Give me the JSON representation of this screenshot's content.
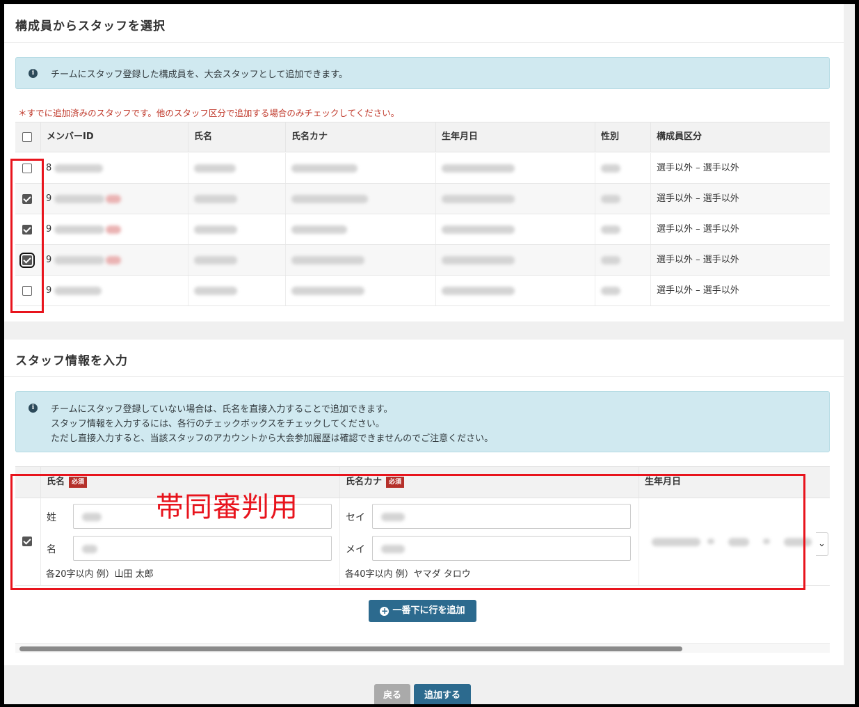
{
  "section_members": {
    "title": "構成員からスタッフを選択",
    "info": "チームにスタッフ登録した構成員を、大会スタッフとして追加できます。",
    "warning": "＊すでに追加済みのスタッフです。他のスタッフ区分で追加する場合のみチェックしてください。",
    "columns": [
      "メンバーID",
      "氏名",
      "氏名カナ",
      "生年月日",
      "性別",
      "構成員区分"
    ],
    "rows": [
      {
        "id_prefix": "8",
        "checked": false,
        "already_added": false,
        "category": "選手以外 – 選手以外"
      },
      {
        "id_prefix": "9",
        "checked": true,
        "already_added": true,
        "category": "選手以外 – 選手以外"
      },
      {
        "id_prefix": "9",
        "checked": true,
        "already_added": true,
        "category": "選手以外 – 選手以外"
      },
      {
        "id_prefix": "9",
        "checked": true,
        "already_added": true,
        "category": "選手以外 – 選手以外"
      },
      {
        "id_prefix": "9",
        "checked": false,
        "already_added": false,
        "category": "選手以外 – 選手以外"
      }
    ]
  },
  "section_input": {
    "title": "スタッフ情報を入力",
    "info_lines": [
      "チームにスタッフ登録していない場合は、氏名を直接入力することで追加できます。",
      "スタッフ情報を入力するには、各行のチェックボックスをチェックしてください。",
      "ただし直接入力すると、当該スタッフのアカウントから大会参加履歴は確認できませんのでご注意ください。"
    ],
    "columns": {
      "name": "氏名",
      "kana": "氏名カナ",
      "birthdate": "生年月日",
      "required_badge": "必須"
    },
    "row": {
      "checked": true,
      "sei_label": "姓",
      "mei_label": "名",
      "sei_kana_label": "セイ",
      "mei_kana_label": "メイ",
      "name_hint": "各20字以内 例）山田 太郎",
      "kana_hint": "各40字以内 例）ヤマダ タロウ",
      "select_arrow": "⌄"
    },
    "add_row_button": "一番下に行を追加"
  },
  "annotation": "帯同審判用",
  "footer": {
    "back_button": "戻る",
    "submit_button": "追加する"
  },
  "colors": {
    "accent": "#2c6a8e",
    "annotation_red": "#e8141d",
    "info_bg": "#d0e9f0",
    "warning": "#c0392b",
    "required_badge": "#b5302a"
  }
}
